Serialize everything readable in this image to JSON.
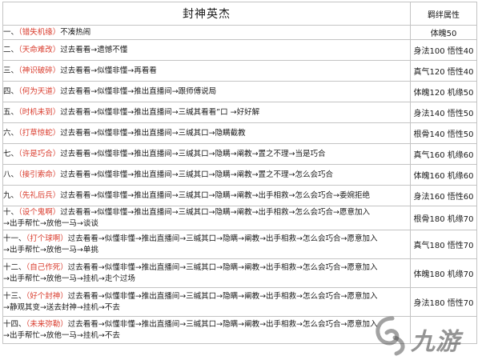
{
  "table": {
    "title": "封神英杰",
    "attr_header": "羁绊属性",
    "rows": [
      {
        "num": "一、",
        "name": "（错失机缘）",
        "text": "不凑热闹",
        "attr": "体魄50"
      },
      {
        "num": "二、",
        "name": "（天命难改）",
        "text": "过去看看→遗憾不懂",
        "attr": "身法100 悟性40"
      },
      {
        "num": "三、",
        "name": "（神识破碎）",
        "text": "过去看看→似懂非懂→再看看",
        "attr": "真气120 悟性40"
      },
      {
        "num": "四、",
        "name": "（何为天道）",
        "text": "过去看看→似懂非懂→推出直播间→跟师傅说局",
        "attr": "体魄120 机缘50"
      },
      {
        "num": "五、",
        "name": "（时机未到）",
        "text": "过去看看→似懂非懂→推出直播间→三缄其看看”口 →好好解",
        "attr": "身法140 悟性50"
      },
      {
        "num": "六、",
        "name": "（打草惊蛇）",
        "text": "过去看看→似懂非懂→推出直播间→三缄其口→隐瞒截教",
        "attr": "根骨140 悟性50"
      },
      {
        "num": "七、",
        "name": "（许是巧合）",
        "text": "过去看看→似懂非懂→推出直播间→三缄其口→隐瞒→阐教→置之不理→当是巧合",
        "attr": "真气160 机缘60"
      },
      {
        "num": "八、",
        "name": "（接引索命）",
        "text": "过去看看→似懂非懂→推出直播间→三缄其口→隐瞒→阐教→置之不理→怎么会巧合",
        "attr": "体魄160 机缘60"
      },
      {
        "num": "九、",
        "name": "（先礼后兵）",
        "text": "过去看看→似懂非懂→推出直播间→三缄其口→隐瞒→阐教→出手相救→怎么会巧合→委婉拒绝",
        "attr": "身法160 悟性60"
      },
      {
        "num": "十、",
        "name": "（设个鬼啊）",
        "text": "过去看看→似懂非懂→推出直播间→三缄其口→隐瞒→阐教→出手相救→怎么会巧合→愿意加入",
        "text2": "→出手帮忙→放他一马→谈谈",
        "attr": "根骨180 机缘70"
      },
      {
        "num": "十一、",
        "name": "（打个球啊）",
        "text": "过去看看→似懂非懂→推出直播间→三缄其口→隐瞒→阐教→出手相救→怎么会巧合→愿意加入",
        "text2": "→出手帮忙→放他一马→单挑",
        "attr": "真气180 悟性70"
      },
      {
        "num": "十二、",
        "name": "（自己作死）",
        "text": "过去看看→似懂非懂→推出直播间→三缄其口→隐瞒→阐教→出手相救→怎么会巧合→愿意加入",
        "text2": "→出手帮忙→放他一马→挂机→走个过场",
        "attr": "体魄180 机缘70"
      },
      {
        "num": "十三、",
        "name": "（好个封神）",
        "text": "过去看看→似懂非懂→推出直播间→三缄其口→隐瞒→阐教→出手相救→怎么会巧合→愿意加入",
        "text2": "→静观其变→送去封神→挂机→不去",
        "attr": "身法180 悟性70"
      },
      {
        "num": "十四、",
        "name": "（未来弥勒）",
        "text": "过去看看→似懂非懂→推出直播间→三缄其口→隐瞒→阐教→出手相救→怎么会巧合→愿意加入",
        "text2": "→出手帮忙→放他一马→挂机→不去",
        "attr": ""
      }
    ]
  },
  "watermark": {
    "text": "九游"
  }
}
